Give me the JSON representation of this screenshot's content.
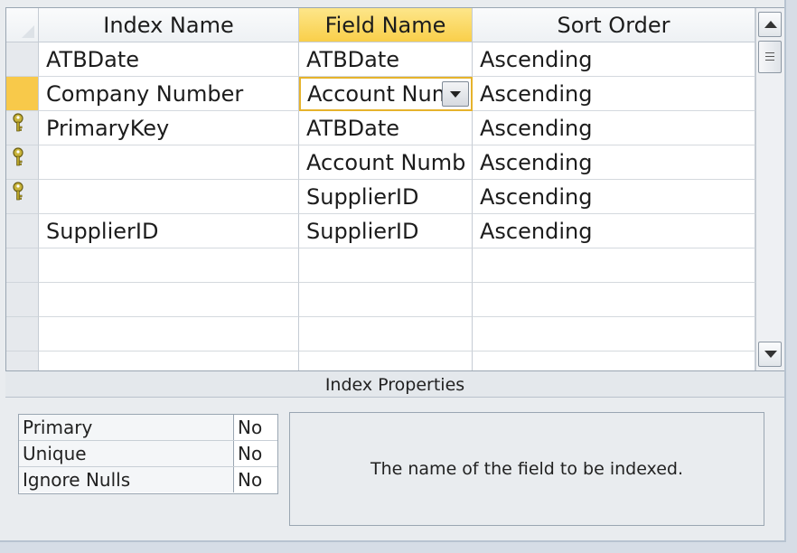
{
  "columns": [
    "Index Name",
    "Field Name",
    "Sort Order"
  ],
  "rows": [
    {
      "key": false,
      "current": false,
      "index_name": "ATBDate",
      "field_name": "ATBDate",
      "sort_order": "Ascending"
    },
    {
      "key": false,
      "current": true,
      "index_name": "Company Number",
      "field_name": "Account Num",
      "sort_order": "Ascending"
    },
    {
      "key": true,
      "current": false,
      "index_name": "PrimaryKey",
      "field_name": "ATBDate",
      "sort_order": "Ascending"
    },
    {
      "key": true,
      "current": false,
      "index_name": "",
      "field_name": "Account Numb",
      "sort_order": "Ascending"
    },
    {
      "key": true,
      "current": false,
      "index_name": "",
      "field_name": "SupplierID",
      "sort_order": "Ascending"
    },
    {
      "key": false,
      "current": false,
      "index_name": "SupplierID",
      "field_name": "SupplierID",
      "sort_order": "Ascending"
    },
    {
      "key": false,
      "current": false,
      "index_name": "",
      "field_name": "",
      "sort_order": ""
    },
    {
      "key": false,
      "current": false,
      "index_name": "",
      "field_name": "",
      "sort_order": ""
    },
    {
      "key": false,
      "current": false,
      "index_name": "",
      "field_name": "",
      "sort_order": ""
    },
    {
      "key": false,
      "current": false,
      "index_name": "",
      "field_name": "",
      "sort_order": ""
    }
  ],
  "properties": {
    "title": "Index Properties",
    "items": [
      {
        "label": "Primary",
        "value": "No"
      },
      {
        "label": "Unique",
        "value": "No"
      },
      {
        "label": "Ignore Nulls",
        "value": "No"
      }
    ],
    "hint": "The name of the field to be indexed."
  },
  "colors": {
    "active_header": "#f9cf4a",
    "current_row_selector": "#f8c94a",
    "edit_border": "#e6b32c",
    "key_icon": "#b8a42a"
  },
  "icons": {
    "key": "key-icon",
    "dropdown": "chevron-down-icon",
    "scroll_up": "arrow-up-icon",
    "scroll_down": "arrow-down-icon"
  }
}
